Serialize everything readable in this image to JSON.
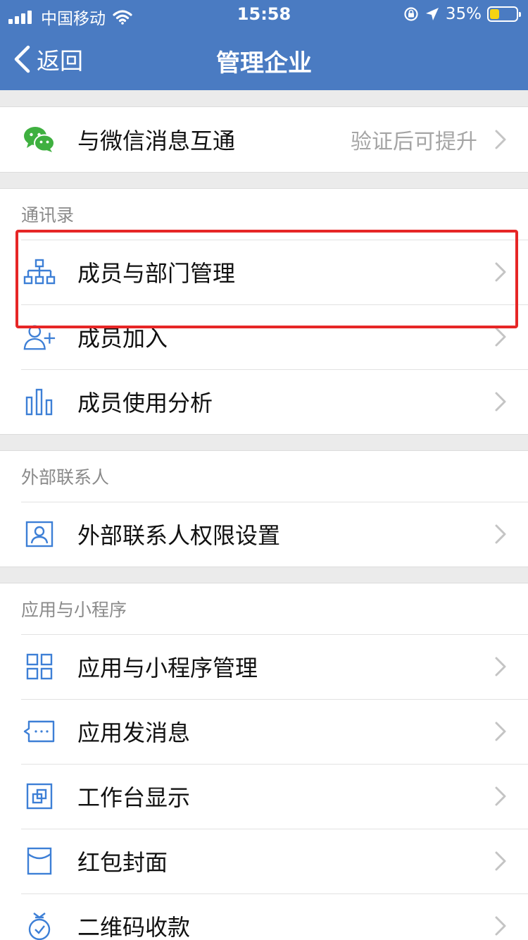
{
  "status_bar": {
    "carrier": "中国移动",
    "time": "15:58",
    "battery": "35%",
    "battery_level": 0.35
  },
  "nav": {
    "back_label": "返回",
    "title": "管理企业"
  },
  "wechat": {
    "label": "与微信消息互通",
    "value": "验证后可提升",
    "icon": "wechat-icon"
  },
  "contacts": {
    "header": "通讯录",
    "items": [
      {
        "label": "成员与部门管理",
        "icon": "org-chart-icon"
      },
      {
        "label": "成员加入",
        "icon": "add-member-icon"
      },
      {
        "label": "成员使用分析",
        "icon": "bar-chart-icon"
      }
    ]
  },
  "external": {
    "header": "外部联系人",
    "items": [
      {
        "label": "外部联系人权限设置",
        "icon": "contact-card-icon"
      }
    ]
  },
  "apps": {
    "header": "应用与小程序",
    "items": [
      {
        "label": "应用与小程序管理",
        "icon": "app-grid-icon"
      },
      {
        "label": "应用发消息",
        "icon": "message-icon"
      },
      {
        "label": "工作台显示",
        "icon": "workbench-icon"
      },
      {
        "label": "红包封面",
        "icon": "red-envelope-icon"
      },
      {
        "label": "二维码收款",
        "icon": "money-bag-icon"
      }
    ]
  },
  "colors": {
    "nav_bar": "#4a7bc2",
    "icon": "#3d7fd6",
    "wechat_green": "#3fb040",
    "highlight": "#e62626"
  }
}
